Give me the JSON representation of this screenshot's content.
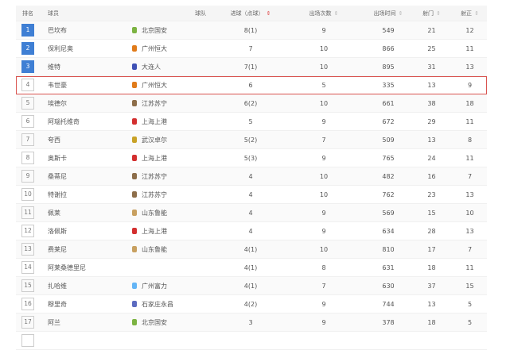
{
  "headers": {
    "rank": "排名",
    "player": "球员",
    "team": "球队",
    "goals": "进球（点球）",
    "apps": "出场次数",
    "minutes": "出场时间",
    "shots": "射门",
    "on_target": "射正",
    "sort_icon": "⇕"
  },
  "colors": {
    "accent": "#3f7fd4",
    "highlight": "#d9534f"
  },
  "rows": [
    {
      "rank": "1",
      "player": "巴坎布",
      "team": "北京国安",
      "team_color": "#7cb342",
      "goals": "8(1)",
      "apps": "9",
      "minutes": "549",
      "shots": "21",
      "on_target": "12"
    },
    {
      "rank": "2",
      "player": "保利尼奥",
      "team": "广州恒大",
      "team_color": "#e07b1a",
      "goals": "7",
      "apps": "10",
      "minutes": "866",
      "shots": "25",
      "on_target": "11"
    },
    {
      "rank": "3",
      "player": "维特",
      "team": "大连人",
      "team_color": "#3f51b5",
      "goals": "7(1)",
      "apps": "10",
      "minutes": "895",
      "shots": "31",
      "on_target": "13"
    },
    {
      "rank": "4",
      "player": "韦世豪",
      "team": "广州恒大",
      "team_color": "#e07b1a",
      "goals": "6",
      "apps": "5",
      "minutes": "335",
      "shots": "13",
      "on_target": "9"
    },
    {
      "rank": "5",
      "player": "埃德尔",
      "team": "江苏苏宁",
      "team_color": "#8d6e4a",
      "goals": "6(2)",
      "apps": "10",
      "minutes": "661",
      "shots": "38",
      "on_target": "18"
    },
    {
      "rank": "6",
      "player": "阿瑙托维奇",
      "team": "上海上港",
      "team_color": "#d32f2f",
      "goals": "5",
      "apps": "9",
      "minutes": "672",
      "shots": "29",
      "on_target": "11"
    },
    {
      "rank": "7",
      "player": "夸西",
      "team": "武汉卓尔",
      "team_color": "#c9a227",
      "goals": "5(2)",
      "apps": "7",
      "minutes": "509",
      "shots": "13",
      "on_target": "8"
    },
    {
      "rank": "8",
      "player": "奥斯卡",
      "team": "上海上港",
      "team_color": "#d32f2f",
      "goals": "5(3)",
      "apps": "9",
      "minutes": "765",
      "shots": "24",
      "on_target": "11"
    },
    {
      "rank": "9",
      "player": "桑蒂尼",
      "team": "江苏苏宁",
      "team_color": "#8d6e4a",
      "goals": "4",
      "apps": "10",
      "minutes": "482",
      "shots": "16",
      "on_target": "7"
    },
    {
      "rank": "10",
      "player": "特谢拉",
      "team": "江苏苏宁",
      "team_color": "#8d6e4a",
      "goals": "4",
      "apps": "10",
      "minutes": "762",
      "shots": "23",
      "on_target": "13"
    },
    {
      "rank": "11",
      "player": "佩莱",
      "team": "山东鲁能",
      "team_color": "#c8a060",
      "goals": "4",
      "apps": "9",
      "minutes": "569",
      "shots": "15",
      "on_target": "10"
    },
    {
      "rank": "12",
      "player": "洛佩斯",
      "team": "上海上港",
      "team_color": "#d32f2f",
      "goals": "4",
      "apps": "9",
      "minutes": "634",
      "shots": "28",
      "on_target": "13"
    },
    {
      "rank": "13",
      "player": "费莱尼",
      "team": "山东鲁能",
      "team_color": "#c8a060",
      "goals": "4(1)",
      "apps": "10",
      "minutes": "810",
      "shots": "17",
      "on_target": "7"
    },
    {
      "rank": "14",
      "player": "阿莱桑德里尼",
      "team": "",
      "team_color": "",
      "goals": "4(1)",
      "apps": "8",
      "minutes": "631",
      "shots": "18",
      "on_target": "11"
    },
    {
      "rank": "15",
      "player": "扎哈维",
      "team": "广州富力",
      "team_color": "#64b5f6",
      "goals": "4(1)",
      "apps": "7",
      "minutes": "630",
      "shots": "37",
      "on_target": "15"
    },
    {
      "rank": "16",
      "player": "穆里奇",
      "team": "石家庄永昌",
      "team_color": "#5c6bc0",
      "goals": "4(2)",
      "apps": "9",
      "minutes": "744",
      "shots": "13",
      "on_target": "5"
    },
    {
      "rank": "17",
      "player": "阿兰",
      "team": "北京国安",
      "team_color": "#7cb342",
      "goals": "3",
      "apps": "9",
      "minutes": "378",
      "shots": "18",
      "on_target": "5"
    }
  ]
}
